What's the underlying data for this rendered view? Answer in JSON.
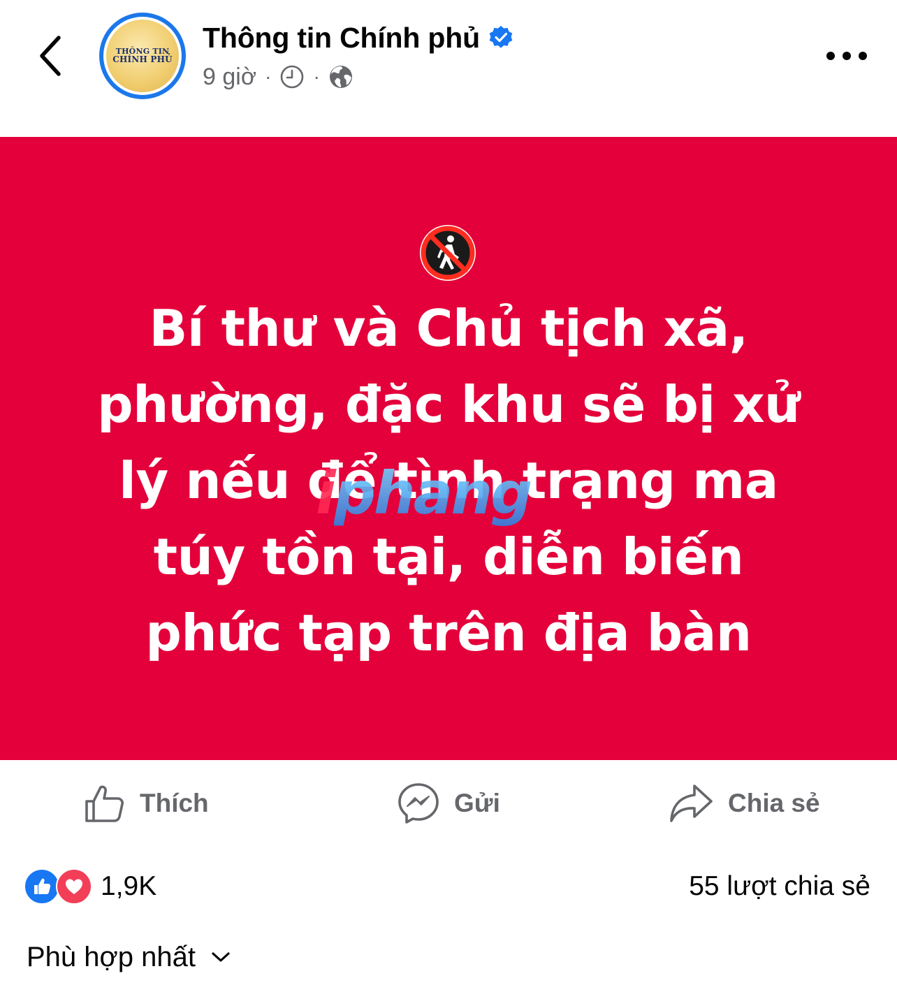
{
  "header": {
    "page_name": "Thông tin Chính phủ",
    "time_ago": "9 giờ",
    "meta_separator": "·",
    "avatar_text_line1": "THÔNG TIN",
    "avatar_text_line2": "CHÍNH PHỦ",
    "icons": {
      "back": "back-arrow-icon",
      "verified": "verified-badge-icon",
      "clock": "clock-icon",
      "audience": "globe-icon",
      "more": "more-options-icon"
    }
  },
  "post": {
    "background_color": "#e3003b",
    "emoji": "no-pedestrians-icon",
    "text_lines": [
      "Bí thư và Chủ tịch xã,",
      "phường, đặc khu sẽ bị xử",
      "lý nếu để tình trạng ma",
      "túy tồn tại, diễn biến",
      "phức tạp trên địa bàn"
    ],
    "watermark": {
      "first": "i",
      "rest": "phang"
    }
  },
  "actions": {
    "like_label": "Thích",
    "send_label": "Gửi",
    "share_label": "Chia sẻ"
  },
  "stats": {
    "reaction_count": "1,9K",
    "share_count": "55 lượt chia sẻ",
    "reaction_types": [
      "like",
      "love"
    ]
  },
  "comments": {
    "sort_label": "Phù hợp nhất"
  },
  "colors": {
    "accent_blue": "#1877f2",
    "love_red": "#f33e58",
    "muted_text": "#65676b"
  }
}
